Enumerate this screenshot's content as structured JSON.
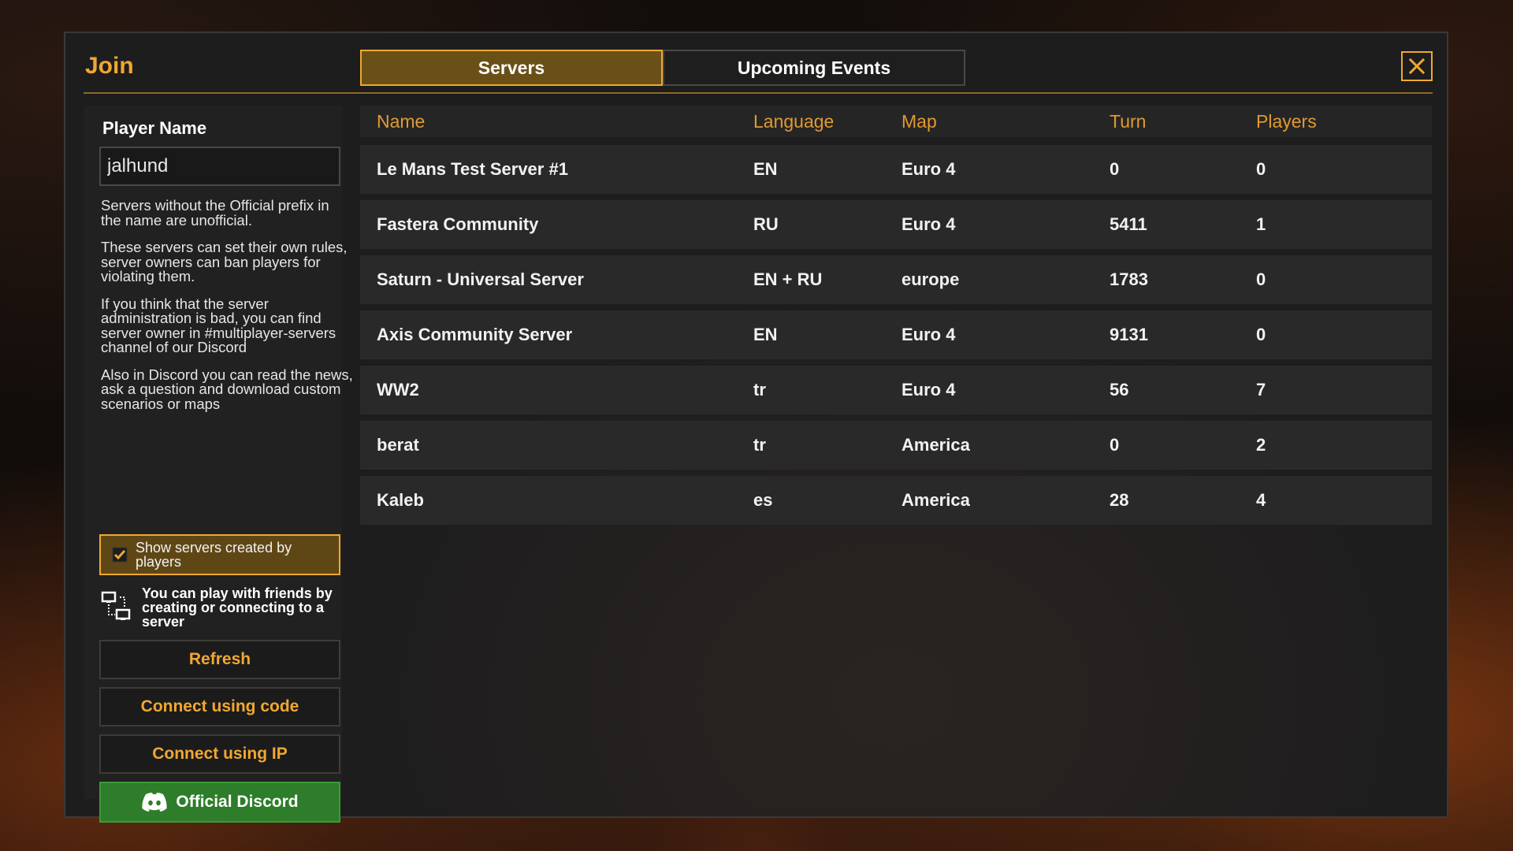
{
  "window": {
    "title": "Join",
    "tabs": [
      {
        "label": "Servers",
        "active": true
      },
      {
        "label": "Upcoming Events",
        "active": false
      }
    ],
    "close_icon": "close-icon"
  },
  "sidebar": {
    "player_name_label": "Player Name",
    "player_name_value": "jalhund",
    "info_paragraphs": [
      "Servers without the Official prefix in the name are unofficial.",
      "These servers can set their own rules, server owners can ban players for violating them.",
      "If you think that the server administration is bad, you can find server owner in #multiplayer-servers channel of our Discord",
      "Also in Discord you can read the news, ask a question and download custom scenarios or maps"
    ],
    "show_player_servers": {
      "label": "Show servers created by players",
      "checked": true
    },
    "friends_hint": "You can play with friends by creating or connecting to a server",
    "buttons": {
      "refresh": "Refresh",
      "connect_code": "Connect using code",
      "connect_ip": "Connect using IP",
      "discord": "Official Discord"
    }
  },
  "table": {
    "columns": [
      "Name",
      "Language",
      "Map",
      "Turn",
      "Players"
    ],
    "rows": [
      {
        "name": "Le Mans Test Server #1",
        "language": "EN",
        "map": "Euro 4",
        "turn": "0",
        "players": "0"
      },
      {
        "name": "Fastera Community",
        "language": "RU",
        "map": "Euro 4",
        "turn": "5411",
        "players": "1"
      },
      {
        "name": "Saturn - Universal Server",
        "language": "EN + RU",
        "map": "europe",
        "turn": "1783",
        "players": "0"
      },
      {
        "name": "Axis Community Server",
        "language": "EN",
        "map": "Euro 4",
        "turn": "9131",
        "players": "0"
      },
      {
        "name": "WW2",
        "language": "tr",
        "map": "Euro 4",
        "turn": "56",
        "players": "7"
      },
      {
        "name": "berat",
        "language": "tr",
        "map": "America",
        "turn": "0",
        "players": "2"
      },
      {
        "name": "Kaleb",
        "language": "es",
        "map": "America",
        "turn": "28",
        "players": "4"
      }
    ]
  },
  "colors": {
    "accent": "#f0a830",
    "panel": "#1e1d1e",
    "row": "#2a292a",
    "discord_green": "#2d7d2a"
  }
}
